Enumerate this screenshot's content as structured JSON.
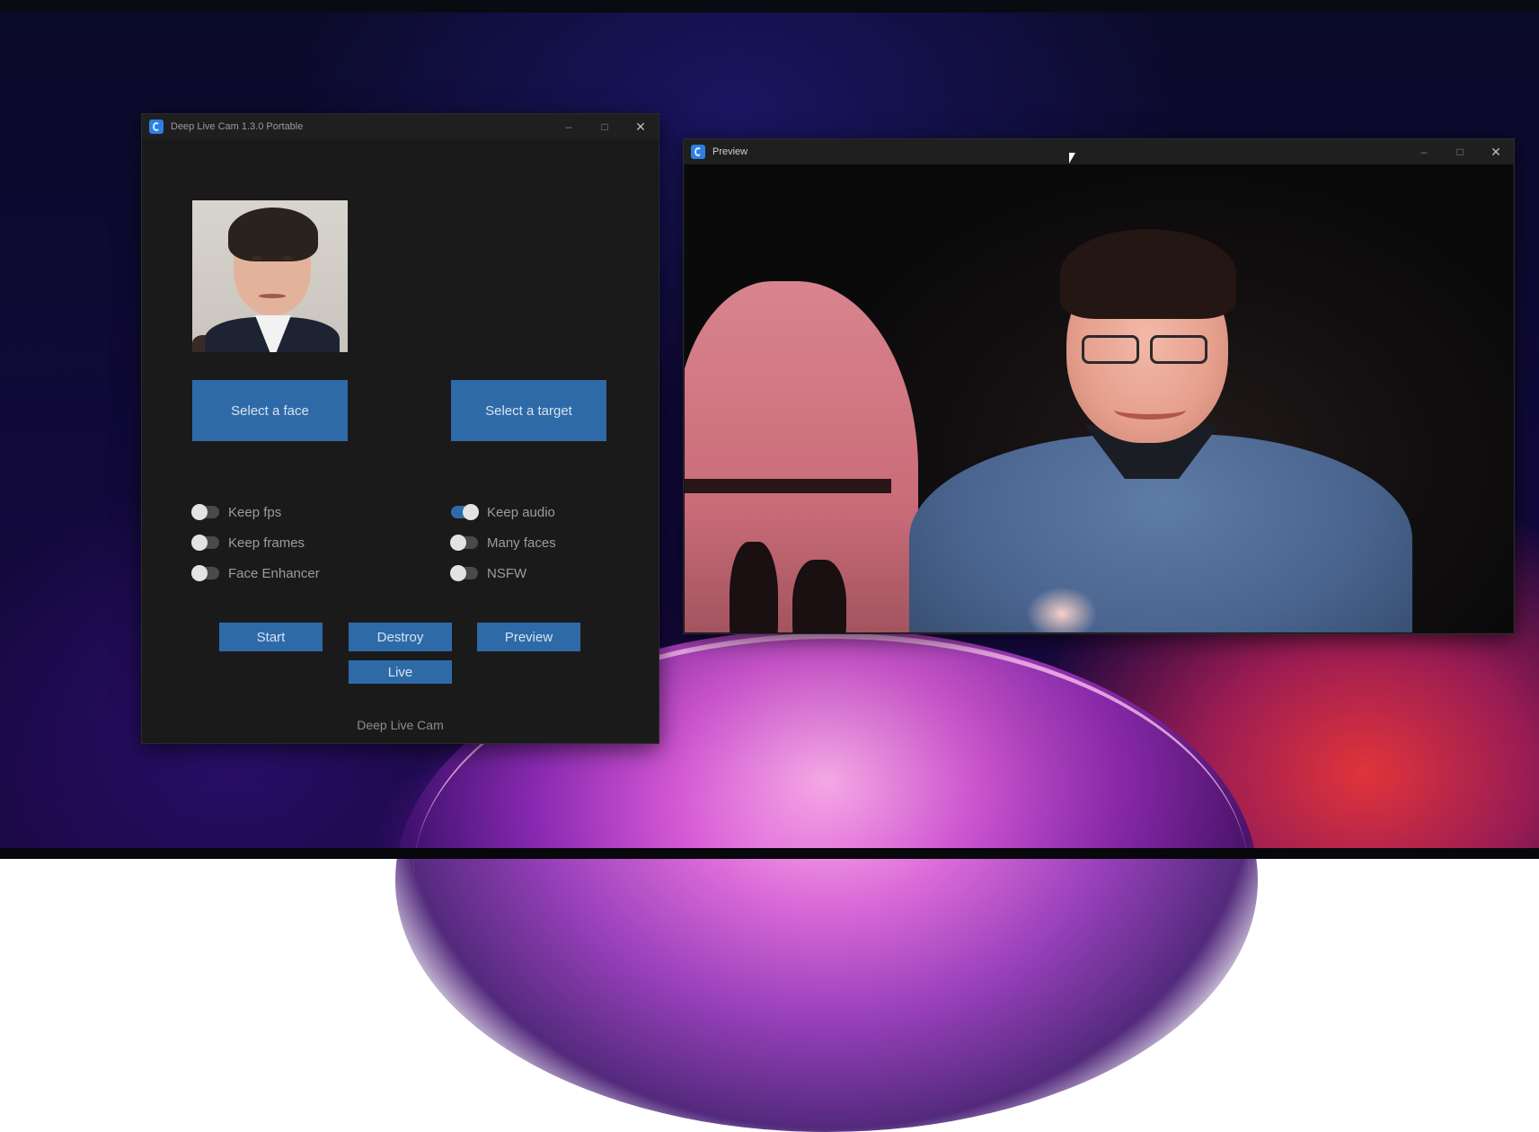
{
  "main_window": {
    "title": "Deep Live Cam 1.3.0 Portable",
    "controls": {
      "minimize": "–",
      "maximize": "□",
      "close": "✕"
    },
    "icon": "app-icon",
    "select_face_label": "Select a face",
    "select_target_label": "Select a target",
    "toggles_left": [
      {
        "label": "Keep fps",
        "on": false
      },
      {
        "label": "Keep frames",
        "on": false
      },
      {
        "label": "Face Enhancer",
        "on": false
      }
    ],
    "toggles_right": [
      {
        "label": "Keep audio",
        "on": true
      },
      {
        "label": "Many faces",
        "on": false
      },
      {
        "label": "NSFW",
        "on": false
      }
    ],
    "start_label": "Start",
    "destroy_label": "Destroy",
    "preview_label": "Preview",
    "live_label": "Live",
    "footer": "Deep Live Cam"
  },
  "preview_window": {
    "title": "Preview",
    "controls": {
      "minimize": "–",
      "maximize": "□",
      "close": "✕"
    },
    "icon": "app-icon"
  },
  "colors": {
    "accent": "#2f6aa8",
    "window_bg": "#1a1a1a"
  }
}
